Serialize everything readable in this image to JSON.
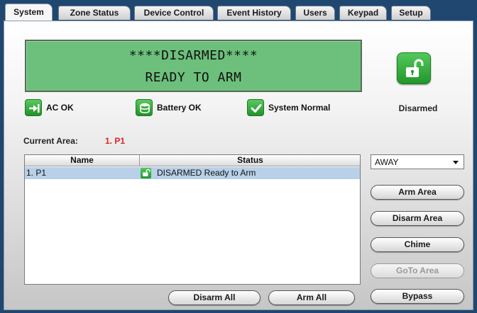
{
  "tabs": [
    {
      "label": "System"
    },
    {
      "label": "Zone Status"
    },
    {
      "label": "Device Control"
    },
    {
      "label": "Event History"
    },
    {
      "label": "Users"
    },
    {
      "label": "Keypad"
    },
    {
      "label": "Setup"
    }
  ],
  "display": {
    "line1": "****DISARMED****",
    "line2": "READY TO ARM",
    "background_color": "#6dbf7c"
  },
  "arm_state": {
    "label": "Disarmed",
    "icon": "unlocked-padlock-icon",
    "color": "#2fae38"
  },
  "indicators": [
    {
      "label": "AC OK",
      "icon": "ac-power-plug-icon"
    },
    {
      "label": "Battery OK",
      "icon": "battery-icon"
    },
    {
      "label": "System Normal",
      "icon": "checkmark-icon"
    }
  ],
  "current_area": {
    "label": "Current Area:",
    "value": "1. P1",
    "value_color": "#e22222"
  },
  "areas_table": {
    "columns": [
      "Name",
      "Status"
    ],
    "rows": [
      {
        "name": "1. P1",
        "status": "DISARMED Ready to Arm",
        "status_icon": "unlocked-padlock-icon",
        "selected": true
      }
    ]
  },
  "arm_mode_select": {
    "value": "AWAY"
  },
  "buttons": {
    "arm_area": "Arm Area",
    "disarm_area": "Disarm Area",
    "chime": "Chime",
    "goto_area": "GoTo Area",
    "bypass": "Bypass",
    "disarm_all": "Disarm All",
    "arm_all": "Arm All"
  }
}
